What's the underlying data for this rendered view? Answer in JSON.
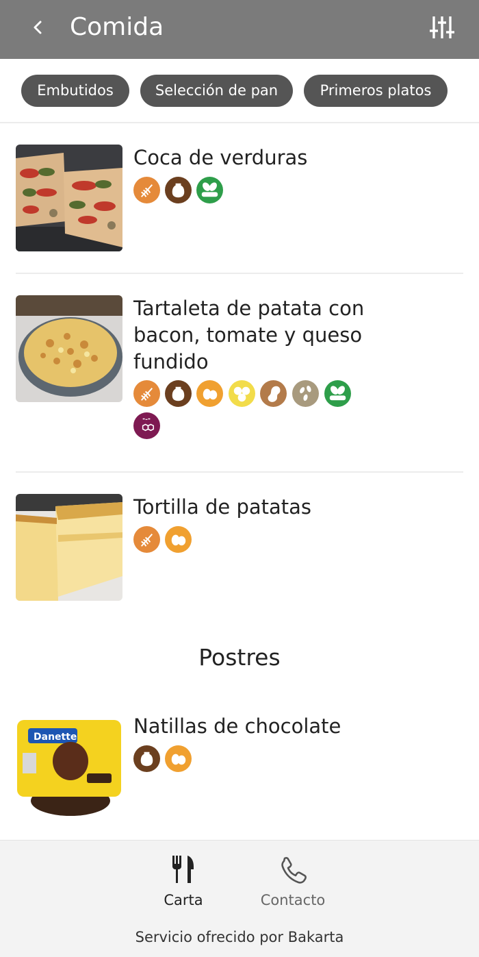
{
  "header": {
    "title": "Comida",
    "back_icon": "chevron-left-icon",
    "filter_icon": "sliders-icon",
    "bg_color": "#7b7b7b"
  },
  "categories": [
    {
      "label": "Embutidos"
    },
    {
      "label": "Selección de pan"
    },
    {
      "label": "Primeros platos"
    }
  ],
  "items": [
    {
      "name": "Coca de verduras",
      "allergens": [
        "gluten",
        "milk",
        "soy"
      ]
    },
    {
      "name": "Tartaleta de patata con bacon, tomate y queso fundido",
      "allergens": [
        "gluten",
        "milk",
        "eggs",
        "lupin",
        "peanuts",
        "sesame",
        "soy",
        "sulphites"
      ]
    },
    {
      "name": "Tortilla de patatas",
      "allergens": [
        "gluten",
        "eggs"
      ]
    }
  ],
  "section": {
    "title": "Postres"
  },
  "dessert_items": [
    {
      "name": "Natillas de chocolate",
      "allergens": [
        "milk",
        "eggs"
      ]
    }
  ],
  "allergen_colors": {
    "gluten": "#e58a3a",
    "milk": "#6b3f1f",
    "soy": "#2e9e4a",
    "eggs": "#f0a030",
    "lupin": "#f2dc4a",
    "peanuts": "#b37b4a",
    "sesame": "#a89a7e",
    "sulphites": "#7e1a52"
  },
  "bottom_nav": {
    "tabs": [
      {
        "label": "Carta",
        "icon": "fork-knife-icon",
        "active": true
      },
      {
        "label": "Contacto",
        "icon": "phone-icon",
        "active": false
      }
    ],
    "footer": "Servicio ofrecido por Bakarta"
  }
}
